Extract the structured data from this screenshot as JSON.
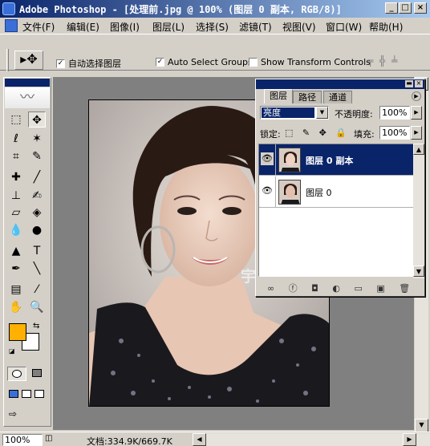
{
  "window": {
    "title": "Adobe Photoshop - [处理前.jpg @ 100% (图层 0 副本, RGB/8)]",
    "buttons": {
      "minimize": "_",
      "maximize": "□",
      "close": "×"
    },
    "doc_buttons": {
      "minimize": "_",
      "restore": "❐",
      "close": "×"
    }
  },
  "menubar": {
    "items": [
      "文件(F)",
      "编辑(E)",
      "图像(I)",
      "图层(L)",
      "选择(S)",
      "滤镜(T)",
      "视图(V)",
      "窗口(W)",
      "帮助(H)"
    ]
  },
  "options": {
    "preset_icon": "move-tool-icon",
    "preset_glyph": "▸✥",
    "auto_select_layer": {
      "label": "自动选择图层",
      "checked": true
    },
    "auto_select_groups": {
      "label": "Auto Select Groups",
      "checked": true
    },
    "show_transform_controls": {
      "label": "Show Transform Controls",
      "checked": false
    },
    "align_glyphs": "╤ ╬ ╧"
  },
  "toolbox": {
    "feather_glyph": "〰",
    "tools": [
      {
        "name": "marquee-tool-icon",
        "glyph": "⬚"
      },
      {
        "name": "move-tool-icon",
        "glyph": "✥",
        "active": true
      },
      {
        "name": "lasso-tool-icon",
        "glyph": "ℓ"
      },
      {
        "name": "magic-wand-tool-icon",
        "glyph": "✶"
      },
      {
        "name": "crop-tool-icon",
        "glyph": "⌗"
      },
      {
        "name": "slice-tool-icon",
        "glyph": "✎"
      },
      {
        "name": "healing-brush-tool-icon",
        "glyph": "✚"
      },
      {
        "name": "brush-tool-icon",
        "glyph": "╱"
      },
      {
        "name": "clone-stamp-tool-icon",
        "glyph": "⊥"
      },
      {
        "name": "history-brush-tool-icon",
        "glyph": "✍"
      },
      {
        "name": "eraser-tool-icon",
        "glyph": "▱"
      },
      {
        "name": "paint-bucket-tool-icon",
        "glyph": "◈"
      },
      {
        "name": "blur-tool-icon",
        "glyph": "💧"
      },
      {
        "name": "dodge-tool-icon",
        "glyph": "●"
      },
      {
        "name": "path-selection-tool-icon",
        "glyph": "▲"
      },
      {
        "name": "type-tool-icon",
        "glyph": "T"
      },
      {
        "name": "pen-tool-icon",
        "glyph": "✒"
      },
      {
        "name": "line-tool-icon",
        "glyph": "╲"
      },
      {
        "name": "notes-tool-icon",
        "glyph": "▤"
      },
      {
        "name": "eyedropper-tool-icon",
        "glyph": "⁄"
      },
      {
        "name": "hand-tool-icon",
        "glyph": "✋"
      },
      {
        "name": "zoom-tool-icon",
        "glyph": "🔍"
      }
    ],
    "foreground_color": "#ffb000",
    "background_color": "#ffffff"
  },
  "status": {
    "zoom": "100%",
    "doc_info": "文档:334.9K/669.7K"
  },
  "layers_panel": {
    "tabs": [
      "图层",
      "路径",
      "通道"
    ],
    "active_tab": "图层",
    "blend_mode": "亮度",
    "opacity_label": "不透明度:",
    "opacity": "100%",
    "lock_label": "锁定:",
    "lock_icons": "⬚ ✎ ✥ 🔒",
    "fill_label": "填充:",
    "fill": "100%",
    "layers": [
      {
        "name": "图层 0 副本",
        "selected": true,
        "visible": true
      },
      {
        "name": "图层 0",
        "selected": false,
        "visible": true
      }
    ],
    "footer_icons": "∞ ⓕ ◘ ◐ ▭ ▣ 🗑"
  },
  "photo": {
    "watermark": "宇夜苍穹出品"
  }
}
